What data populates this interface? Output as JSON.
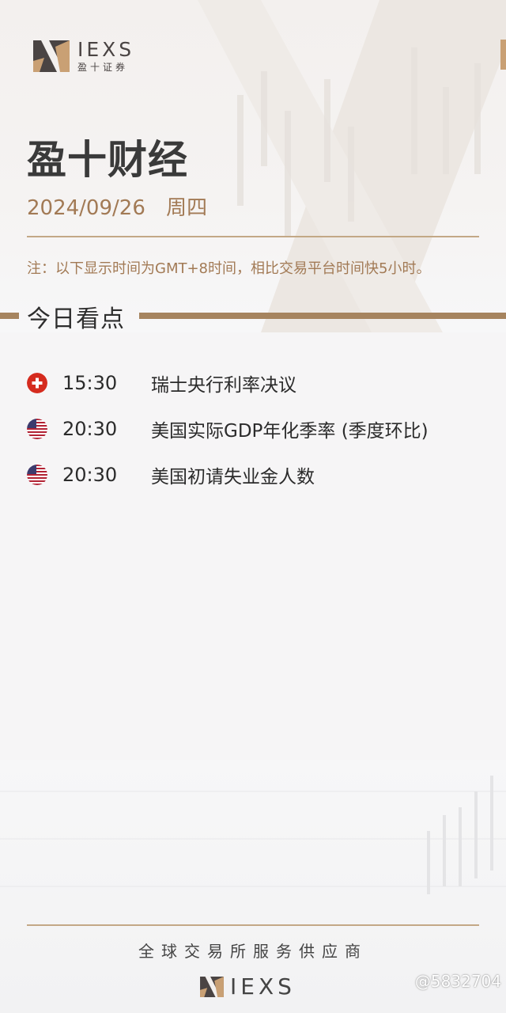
{
  "header": {
    "brand": "IEXS",
    "brand_sub": "盈十证券"
  },
  "title": "盈十财经",
  "date": "2024/09/26",
  "weekday": "周四",
  "note": "注：以下显示时间为GMT+8时间，相比交易平台时间快5小时。",
  "section_title": "今日看点",
  "events": [
    {
      "flag": "switzerland-flag-icon",
      "time": "15:30",
      "title": "瑞士央行利率决议"
    },
    {
      "flag": "us-flag-icon",
      "time": "20:30",
      "title": "美国实际GDP年化季率 (季度环比)"
    },
    {
      "flag": "us-flag-icon",
      "time": "20:30",
      "title": "美国初请失业金人数"
    }
  ],
  "footer": {
    "tagline": "全球交易所服务供应商",
    "brand": "IEXS"
  },
  "watermark": "@5832704",
  "colors": {
    "accent": "#a6845f",
    "gold_text": "#a27a55",
    "logo_tan": "#c9a074"
  }
}
